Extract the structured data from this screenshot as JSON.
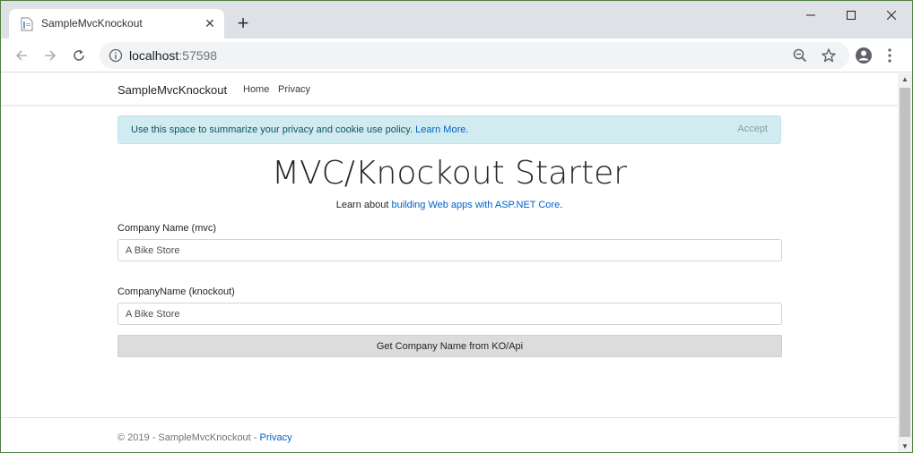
{
  "browser": {
    "tab_title": "SampleMvcKnockout",
    "tab_close": "✕",
    "new_tab": "+",
    "url_host": "localhost",
    "url_port": ":57598"
  },
  "site": {
    "brand": "SampleMvcKnockout",
    "nav": [
      {
        "label": "Home"
      },
      {
        "label": "Privacy"
      }
    ]
  },
  "cookie_alert": {
    "text": "Use this space to summarize your privacy and cookie use policy.",
    "link": "Learn More",
    "period": ".",
    "accept": "Accept"
  },
  "main": {
    "title": "MVC/Knockout Starter",
    "lead_prefix": "Learn about ",
    "lead_link": "building Web apps with ASP.NET Core",
    "lead_suffix": ".",
    "mvc_label": "Company Name (mvc)",
    "mvc_value": "A Bike Store",
    "ko_label": "CompanyName (knockout)",
    "ko_value": "A Bike Store",
    "button": "Get Company Name from KO/Api"
  },
  "footer": {
    "text": "© 2019 - SampleMvcKnockout - ",
    "link": "Privacy"
  }
}
